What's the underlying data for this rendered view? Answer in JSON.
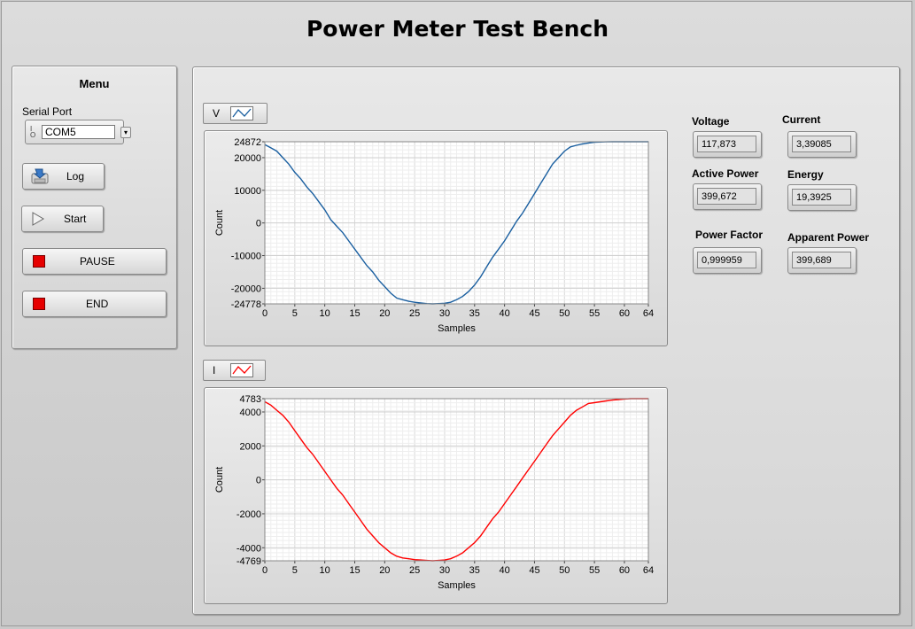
{
  "app": {
    "title": "Power Meter Test Bench"
  },
  "menu": {
    "title": "Menu",
    "serial_label": "Serial Port",
    "serial_value": "COM5",
    "serial_io_glyph": "I/O",
    "buttons": {
      "log": "Log",
      "start": "Start",
      "pause": "PAUSE",
      "end": "END"
    }
  },
  "colors": {
    "voltage_plot": "#1a5fa0",
    "current_plot": "#ff0000",
    "stop_buttons": "#e60000"
  },
  "indicators": {
    "voltage": {
      "label": "Voltage",
      "value": "117,873"
    },
    "current": {
      "label": "Current",
      "value": "3,39085"
    },
    "active_power": {
      "label": "Active Power",
      "value": "399,672"
    },
    "energy": {
      "label": "Energy",
      "value": "19,3925"
    },
    "power_factor": {
      "label": "Power Factor",
      "value": "0,999959"
    },
    "apparent_power": {
      "label": "Apparent Power",
      "value": "399,689"
    }
  },
  "chart_data": [
    {
      "type": "line",
      "legend_label": "V",
      "xlabel": "Samples",
      "ylabel": "Count",
      "xlim": [
        0,
        64
      ],
      "ylim": [
        -24778,
        24872
      ],
      "xticks": [
        0,
        5,
        10,
        15,
        20,
        25,
        30,
        35,
        40,
        45,
        50,
        55,
        60,
        64
      ],
      "yticks": [
        24872,
        20000,
        10000,
        0,
        -10000,
        -20000,
        -24778
      ],
      "grid": true,
      "series": [
        {
          "color": "#1a5fa0",
          "x": [
            0,
            1,
            2,
            3,
            4,
            5,
            6,
            7,
            8,
            9,
            10,
            11,
            12,
            13,
            14,
            15,
            16,
            17,
            18,
            19,
            20,
            21,
            22,
            23,
            24,
            25,
            26,
            27,
            28,
            29,
            30,
            31,
            32,
            33,
            34,
            35,
            36,
            37,
            38,
            39,
            40,
            41,
            42,
            43,
            44,
            45,
            46,
            47,
            48,
            49,
            50,
            51,
            52,
            53,
            54,
            55,
            56,
            57,
            58,
            59,
            60,
            61,
            62,
            63,
            64
          ],
          "y": [
            24000,
            23000,
            22000,
            20000,
            18000,
            15500,
            13500,
            11000,
            9000,
            6500,
            4000,
            1000,
            -1000,
            -3000,
            -5500,
            -8000,
            -10500,
            -13000,
            -15000,
            -17500,
            -19500,
            -21500,
            -23000,
            -23500,
            -24000,
            -24300,
            -24500,
            -24700,
            -24778,
            -24700,
            -24600,
            -24300,
            -23500,
            -22500,
            -21000,
            -19000,
            -16500,
            -13500,
            -10500,
            -8000,
            -5500,
            -2500,
            500,
            3000,
            6000,
            9000,
            12000,
            15000,
            18000,
            20000,
            22000,
            23300,
            23800,
            24200,
            24500,
            24700,
            24800,
            24850,
            24872,
            24872,
            24872,
            24872,
            24872,
            24872,
            24872
          ]
        }
      ]
    },
    {
      "type": "line",
      "legend_label": "I",
      "xlabel": "Samples",
      "ylabel": "Count",
      "xlim": [
        0,
        64
      ],
      "ylim": [
        -4769,
        4783
      ],
      "xticks": [
        0,
        5,
        10,
        15,
        20,
        25,
        30,
        35,
        40,
        45,
        50,
        55,
        60,
        64
      ],
      "yticks": [
        4783,
        4000,
        2000,
        0,
        -2000,
        -4000,
        -4769
      ],
      "grid": true,
      "series": [
        {
          "color": "#ff0000",
          "x": [
            0,
            1,
            2,
            3,
            4,
            5,
            6,
            7,
            8,
            9,
            10,
            11,
            12,
            13,
            14,
            15,
            16,
            17,
            18,
            19,
            20,
            21,
            22,
            23,
            24,
            25,
            26,
            27,
            28,
            29,
            30,
            31,
            32,
            33,
            34,
            35,
            36,
            37,
            38,
            39,
            40,
            41,
            42,
            43,
            44,
            45,
            46,
            47,
            48,
            49,
            50,
            51,
            52,
            53,
            54,
            55,
            56,
            57,
            58,
            59,
            60,
            61,
            62,
            63,
            64
          ],
          "y": [
            4600,
            4400,
            4100,
            3800,
            3400,
            2900,
            2400,
            1900,
            1500,
            1000,
            500,
            0,
            -500,
            -900,
            -1400,
            -1900,
            -2400,
            -2900,
            -3300,
            -3700,
            -4000,
            -4300,
            -4500,
            -4600,
            -4650,
            -4700,
            -4720,
            -4750,
            -4769,
            -4750,
            -4720,
            -4650,
            -4500,
            -4300,
            -4000,
            -3700,
            -3300,
            -2800,
            -2300,
            -1900,
            -1400,
            -900,
            -400,
            100,
            600,
            1100,
            1600,
            2100,
            2600,
            3000,
            3400,
            3800,
            4100,
            4300,
            4500,
            4550,
            4600,
            4650,
            4700,
            4730,
            4760,
            4783,
            4783,
            4783,
            4783
          ]
        }
      ]
    }
  ]
}
